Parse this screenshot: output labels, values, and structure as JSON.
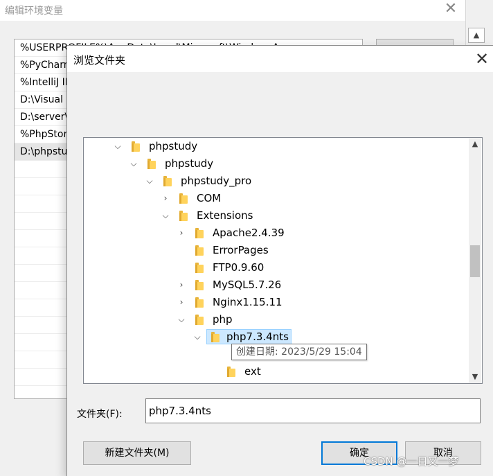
{
  "background_dialog": {
    "title": "编辑环境变量",
    "close_glyph": "✕",
    "rows": [
      "%USERPROFILE%\\AppData\\Local\\Microsoft\\WindowsApps",
      "%PyCharm%",
      "%IntelliJ IDEA%",
      "D:\\Visual Studio Code\\bin",
      "D:\\server\\",
      "%PhpStorm%",
      "D:\\phpstudy",
      "",
      "",
      "",
      "",
      "",
      "",
      "",
      "",
      "",
      "",
      "",
      "",
      "",
      ""
    ],
    "selected_row_index": 6
  },
  "browse_dialog": {
    "title": "浏览文件夹",
    "close_glyph": "✕",
    "tree": [
      {
        "label": "phpstudy",
        "expand": "expanded"
      },
      {
        "label": "phpstudy",
        "expand": "expanded"
      },
      {
        "label": "phpstudy_pro",
        "expand": "expanded"
      },
      {
        "label": "COM",
        "expand": "collapsed"
      },
      {
        "label": "Extensions",
        "expand": "expanded"
      },
      {
        "label": "Apache2.4.39",
        "expand": "collapsed"
      },
      {
        "label": "ErrorPages",
        "expand": "none"
      },
      {
        "label": "FTP0.9.60",
        "expand": "none"
      },
      {
        "label": "MySQL5.7.26",
        "expand": "collapsed"
      },
      {
        "label": "Nginx1.15.11",
        "expand": "collapsed"
      },
      {
        "label": "php",
        "expand": "expanded"
      },
      {
        "label": "php7.3.4nts",
        "expand": "expanded",
        "selected": true
      },
      {
        "label": "",
        "expand": "none"
      },
      {
        "label": "ext",
        "expand": "none"
      }
    ],
    "tooltip": "创建日期: 2023/5/29 15:04",
    "folder_label": "文件夹(F):",
    "folder_value": "php7.3.4nts",
    "buttons": {
      "new_folder": "新建文件夹(M)",
      "ok": "确定",
      "cancel": "取消"
    }
  },
  "watermark": "CSDN @一日又一梦",
  "colors": {
    "selection_bg": "#cce8ff",
    "folder_yellow": "#ffd35c",
    "default_button_border": "#0078d7"
  },
  "icons": {
    "expanded": "chevron-down-icon",
    "collapsed": "chevron-right-icon",
    "folder": "folder-icon"
  }
}
